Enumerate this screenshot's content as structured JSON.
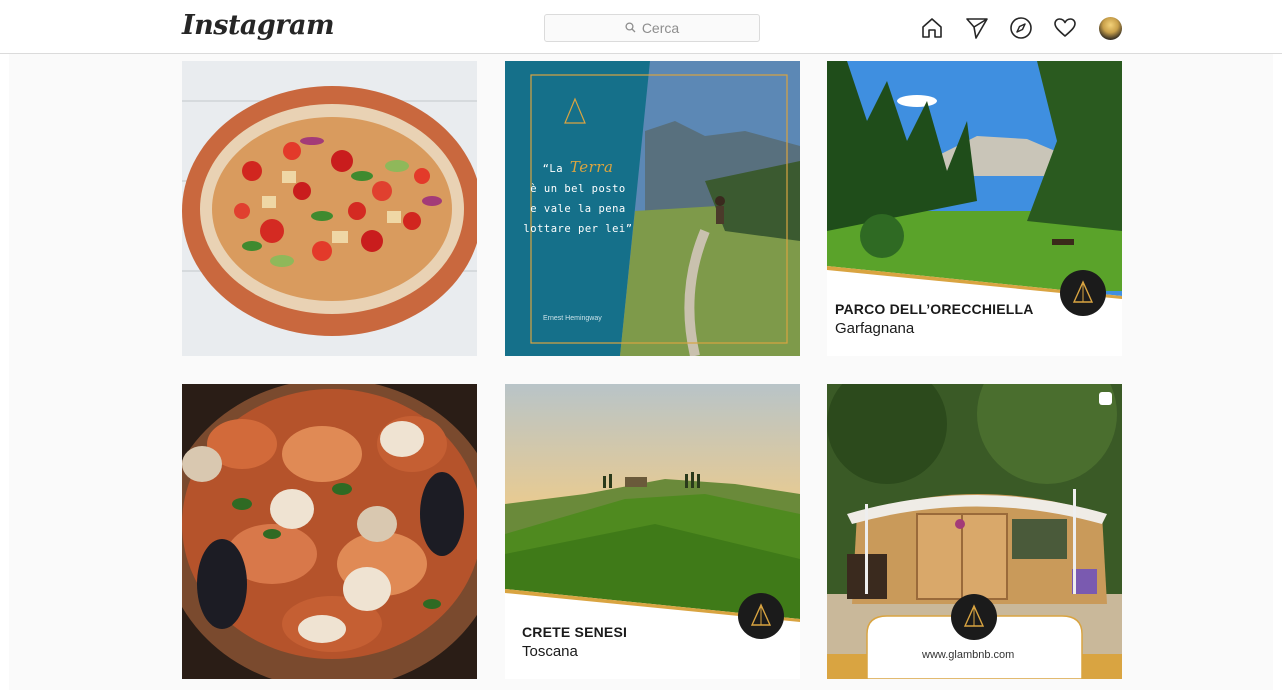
{
  "header": {
    "logo": "Instagram",
    "search_placeholder": "Cerca"
  },
  "nav": {
    "icons": [
      "home-icon",
      "direct-icon",
      "explore-icon",
      "activity-icon",
      "profile-avatar"
    ]
  },
  "posts": [
    {
      "type": "image",
      "subject": "panzanella-salad"
    },
    {
      "type": "quote",
      "quote_open": "“La",
      "quote_highlight": "Terra",
      "quote_line2": "è un bel posto",
      "quote_line3": "e vale la pena",
      "quote_line4": "lottare per lei”",
      "author": "Ernest Hemingway",
      "logo_text": "glambnb"
    },
    {
      "type": "place",
      "title": "PARCO DELL’ORECCHIELLA",
      "subtitle": "Garfagnana"
    },
    {
      "type": "image",
      "subject": "seafood-stew"
    },
    {
      "type": "place",
      "title": "CRETE SENESI",
      "subtitle": "Toscana"
    },
    {
      "type": "promo",
      "url": "www.glambnb.com",
      "multi": true
    }
  ],
  "colors": {
    "accent_gold": "#d9a441",
    "teal": "#15708a",
    "border": "#dbdbdb"
  }
}
